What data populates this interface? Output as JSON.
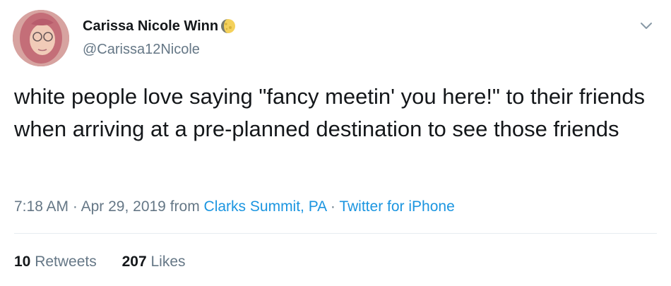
{
  "author": {
    "display_name": "Carissa Nicole Winn",
    "handle": "@Carissa12Nicole",
    "name_emoji_icon": "moon-icon",
    "avatar_icon": "avatar"
  },
  "tweet": {
    "text": "white people love saying \"fancy meetin' you here!\" to their friends when arriving at a pre-planned destination to see those friends"
  },
  "meta": {
    "time": "7:18 AM",
    "separator": "·",
    "date": "Apr 29, 2019",
    "from_label": "from",
    "location": "Clarks Summit, PA",
    "source": "Twitter for iPhone"
  },
  "stats": {
    "retweets_count": "10",
    "retweets_label": "Retweets",
    "likes_count": "207",
    "likes_label": "Likes"
  },
  "colors": {
    "text": "#14171a",
    "secondary": "#657786",
    "link": "#1b95e0",
    "divider": "#e6ecf0"
  }
}
